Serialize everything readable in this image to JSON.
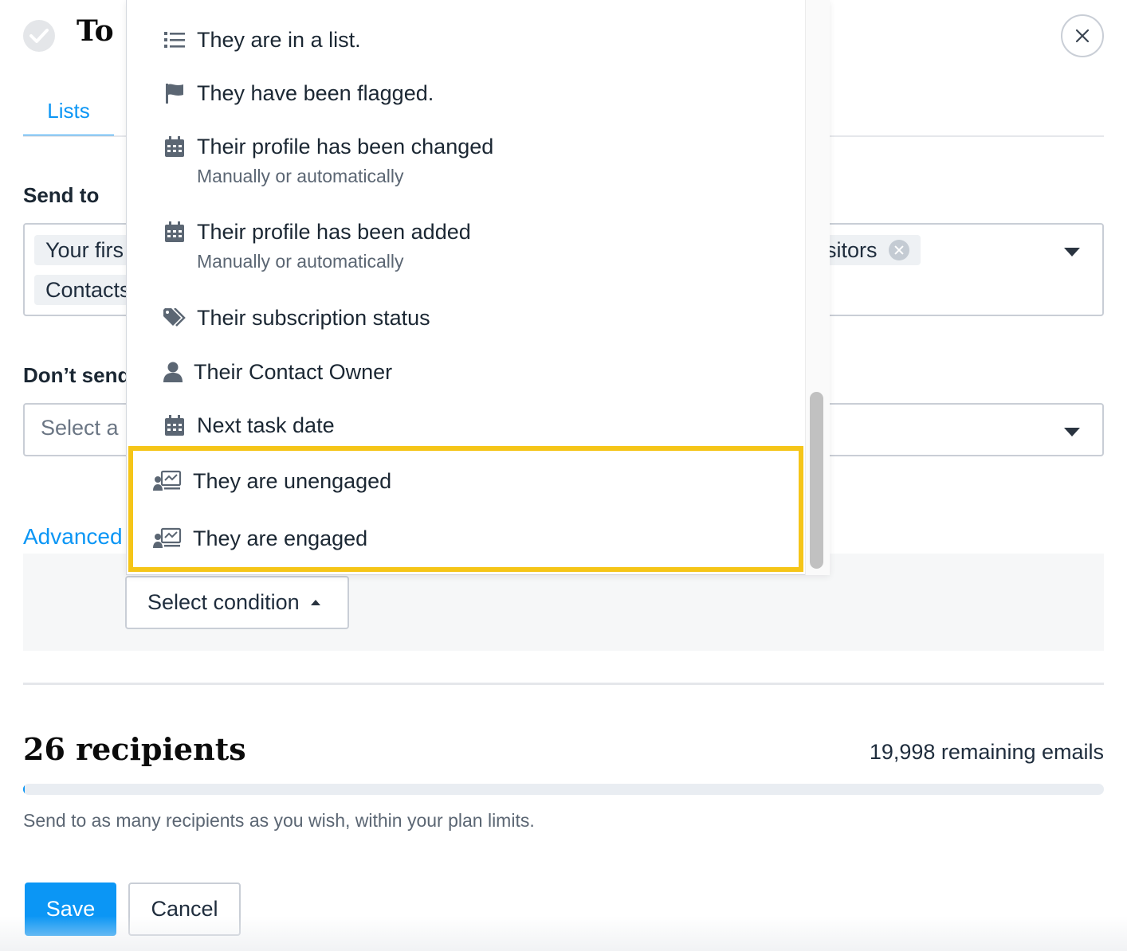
{
  "header": {
    "title": "To"
  },
  "tabs": {
    "lists_label": "Lists"
  },
  "send_to": {
    "label": "Send to",
    "tags": [
      "Your firs",
      "Contacts",
      "isitors"
    ]
  },
  "dont_send": {
    "label": "Don’t send",
    "placeholder": "Select a"
  },
  "advanced": {
    "link_label": "Advanced",
    "select_condition_label": "Select condition"
  },
  "dropdown": {
    "items": [
      {
        "label": "They are in a list.",
        "icon": "list-icon"
      },
      {
        "label": "They have been flagged.",
        "icon": "flag-icon"
      },
      {
        "label": "Their profile has been changed",
        "sub": "Manually or automatically",
        "icon": "calendar-icon"
      },
      {
        "label": "Their profile has been added",
        "sub": "Manually or automatically",
        "icon": "calendar-icon"
      },
      {
        "label": "Their subscription status",
        "icon": "tags-icon"
      },
      {
        "label": "Their Contact Owner",
        "icon": "user-icon"
      },
      {
        "label": "Next task date",
        "icon": "calendar-icon"
      },
      {
        "label": "They are unengaged",
        "icon": "engagement-icon"
      },
      {
        "label": "They are engaged",
        "icon": "engagement-icon"
      }
    ],
    "highlight_color": "#f5c518"
  },
  "summary": {
    "recipients": "26 recipients",
    "remaining": "19,998 remaining emails",
    "progress_fraction": 0.0013,
    "helper": "Send to as many recipients as you wish, within your plan limits."
  },
  "actions": {
    "save_label": "Save",
    "cancel_label": "Cancel"
  },
  "colors": {
    "accent": "#0b96f5",
    "highlight": "#f5c518"
  }
}
